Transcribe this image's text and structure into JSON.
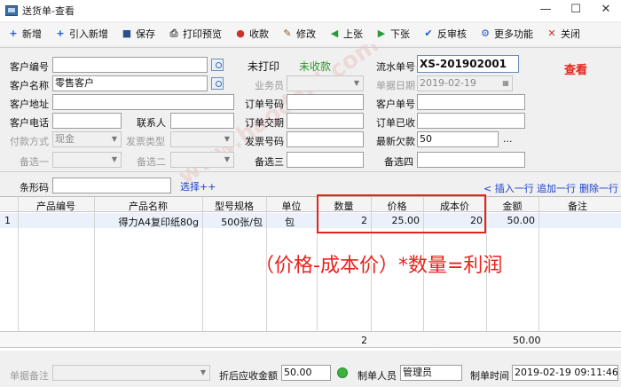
{
  "window": {
    "title": "送货单-查看",
    "minimize": "—",
    "maximize": "☐",
    "close": "✕"
  },
  "toolbar": [
    {
      "label": "新增",
      "icon": "plus-icon",
      "glyph": "+",
      "color": "#1e5bd6"
    },
    {
      "label": "引入新增",
      "icon": "plus-icon",
      "glyph": "+",
      "color": "#1e5bd6"
    },
    {
      "label": "保存",
      "icon": "save-icon",
      "glyph": "■",
      "color": "#2c4f8a"
    },
    {
      "label": "打印预览",
      "icon": "printer-icon",
      "glyph": "⎙",
      "color": "#444"
    },
    {
      "label": "收款",
      "icon": "coins-icon",
      "glyph": "●",
      "color": "#d0302a"
    },
    {
      "label": "修改",
      "icon": "edit-icon",
      "glyph": "✎",
      "color": "#8a5a2a"
    },
    {
      "label": "上张",
      "icon": "prev-icon",
      "glyph": "◀",
      "color": "#2a9a3a"
    },
    {
      "label": "下张",
      "icon": "next-icon",
      "glyph": "▶",
      "color": "#2a9a3a"
    },
    {
      "label": "反审核",
      "icon": "unaudit-icon",
      "glyph": "✔",
      "color": "#1e5bd6"
    },
    {
      "label": "更多功能",
      "icon": "gear-icon",
      "glyph": "⚙",
      "color": "#1e5bd6"
    },
    {
      "label": "关闭",
      "icon": "close-icon",
      "glyph": "✕",
      "color": "#d0302a"
    }
  ],
  "form": {
    "customer_code_label": "客户编号",
    "customer_code": "",
    "customer_name_label": "客户名称",
    "customer_name": "零售客户",
    "customer_addr_label": "客户地址",
    "customer_addr": "",
    "customer_phone_label": "客户电话",
    "customer_phone": "",
    "contact_label": "联系人",
    "contact": "",
    "payment_label": "付款方式",
    "payment": "现金",
    "invoice_type_label": "发票类型",
    "invoice_type": "",
    "backup1_label": "备选一",
    "backup1": "",
    "backup2_label": "备选二",
    "backup2": "",
    "print_status": "未打印",
    "collect_status": "未收款",
    "salesman_label": "业务员",
    "salesman": "",
    "order_no_label": "订单号码",
    "order_no": "",
    "order_delivery_label": "订单交期",
    "order_delivery": "",
    "invoice_no_label": "发票号码",
    "invoice_no": "",
    "backup3_label": "备选三",
    "backup3": "",
    "serial_label": "流水单号",
    "serial": "XS-201902001",
    "doc_date_label": "单据日期",
    "doc_date": "2019-02-19",
    "cust_order_label": "客户单号",
    "cust_order": "",
    "order_received_label": "订单已收",
    "order_received": "",
    "latest_debt_label": "最新欠款",
    "latest_debt": "50",
    "more": "...",
    "backup4_label": "备选四",
    "backup4": "",
    "view_stamp": "查看",
    "barcode_label": "条形码",
    "barcode": "",
    "select_link": "选择++",
    "insert_row": "< 插入一行",
    "append_row": "追加一行",
    "delete_row": "删除一行"
  },
  "table": {
    "columns": [
      "产品编号",
      "产品名称",
      "型号规格",
      "单位",
      "数量",
      "价格",
      "成本价",
      "金额",
      "备注"
    ],
    "rows": [
      {
        "idx": "1",
        "code": "",
        "name": "得力A4复印纸80g",
        "spec": "500张/包",
        "unit": "包",
        "qty": "2",
        "price": "25.00",
        "cost": "20",
        "amount": "50.00",
        "remark": ""
      }
    ],
    "footer": {
      "qty": "2",
      "amount": "50.00"
    }
  },
  "annotation": "（价格-成本价）*数量=利润",
  "watermark": "www.haodeld.com",
  "bottom": {
    "remark_label": "单据备注",
    "remark": "",
    "receivable_label": "折后应收金额",
    "receivable": "50.00",
    "creator_label": "制单人员",
    "creator": "管理员",
    "created_label": "制单时间",
    "created": "2019-02-19 09:11:46"
  }
}
